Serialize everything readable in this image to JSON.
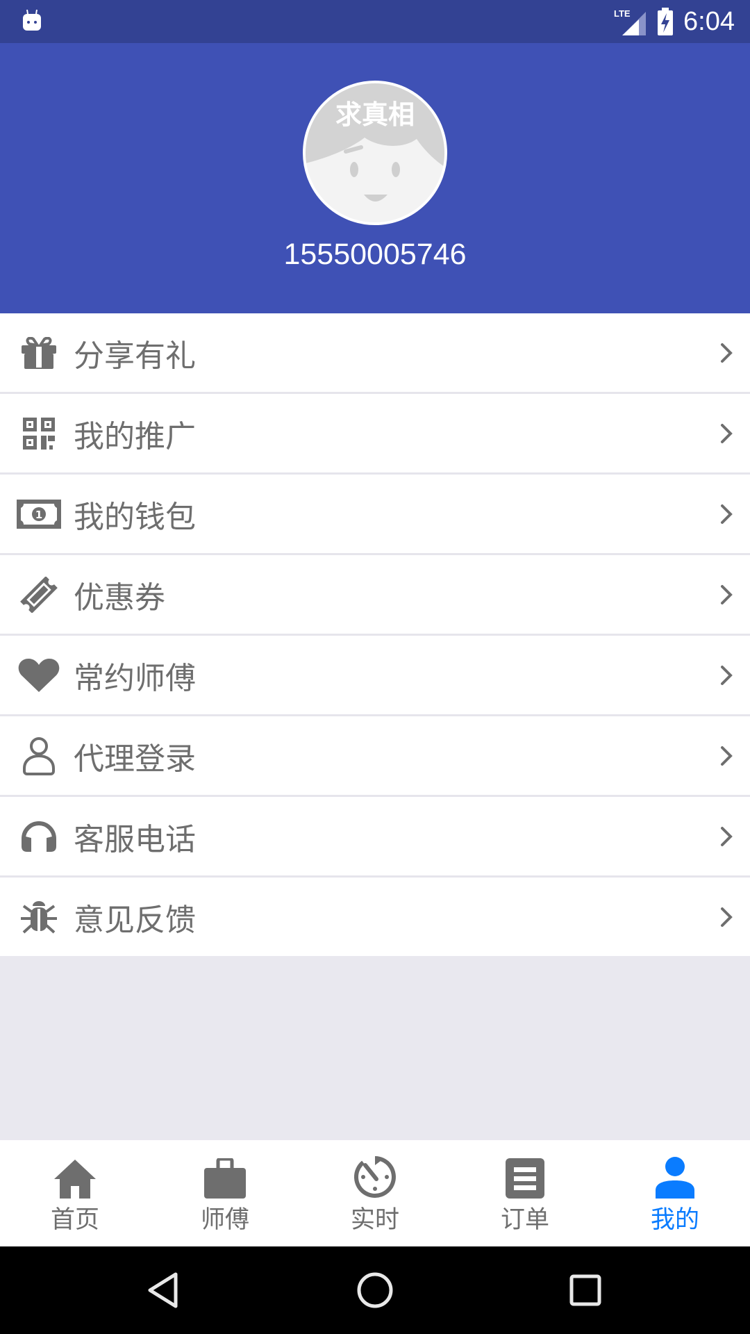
{
  "status_bar": {
    "time": "6:04",
    "network": "LTE",
    "icons": [
      "android-notification-icon",
      "lte-signal-icon",
      "battery-charging-icon"
    ]
  },
  "profile": {
    "avatar_text": "求真相",
    "phone_number": "15550005746"
  },
  "menu": {
    "items": [
      {
        "label": "分享有礼",
        "icon": "gift-icon"
      },
      {
        "label": "我的推广",
        "icon": "qr-code-icon"
      },
      {
        "label": "我的钱包",
        "icon": "money-bill-icon"
      },
      {
        "label": "优惠券",
        "icon": "ticket-icon"
      },
      {
        "label": "常约师傅",
        "icon": "heart-icon"
      },
      {
        "label": "代理登录",
        "icon": "user-outline-icon"
      },
      {
        "label": "客服电话",
        "icon": "headphones-icon"
      },
      {
        "label": "意见反馈",
        "icon": "bug-icon"
      }
    ]
  },
  "tabbar": {
    "tabs": [
      {
        "label": "首页",
        "icon": "home-icon",
        "active": false
      },
      {
        "label": "师傅",
        "icon": "briefcase-icon",
        "active": false
      },
      {
        "label": "实时",
        "icon": "timer-icon",
        "active": false
      },
      {
        "label": "订单",
        "icon": "order-list-icon",
        "active": false
      },
      {
        "label": "我的",
        "icon": "person-icon",
        "active": true
      }
    ]
  },
  "colors": {
    "status_bar": "#334293",
    "header": "#3f51b5",
    "accent": "#0a7cff",
    "icon_gray": "#6e6e6e",
    "background": "#e9e8ef"
  }
}
